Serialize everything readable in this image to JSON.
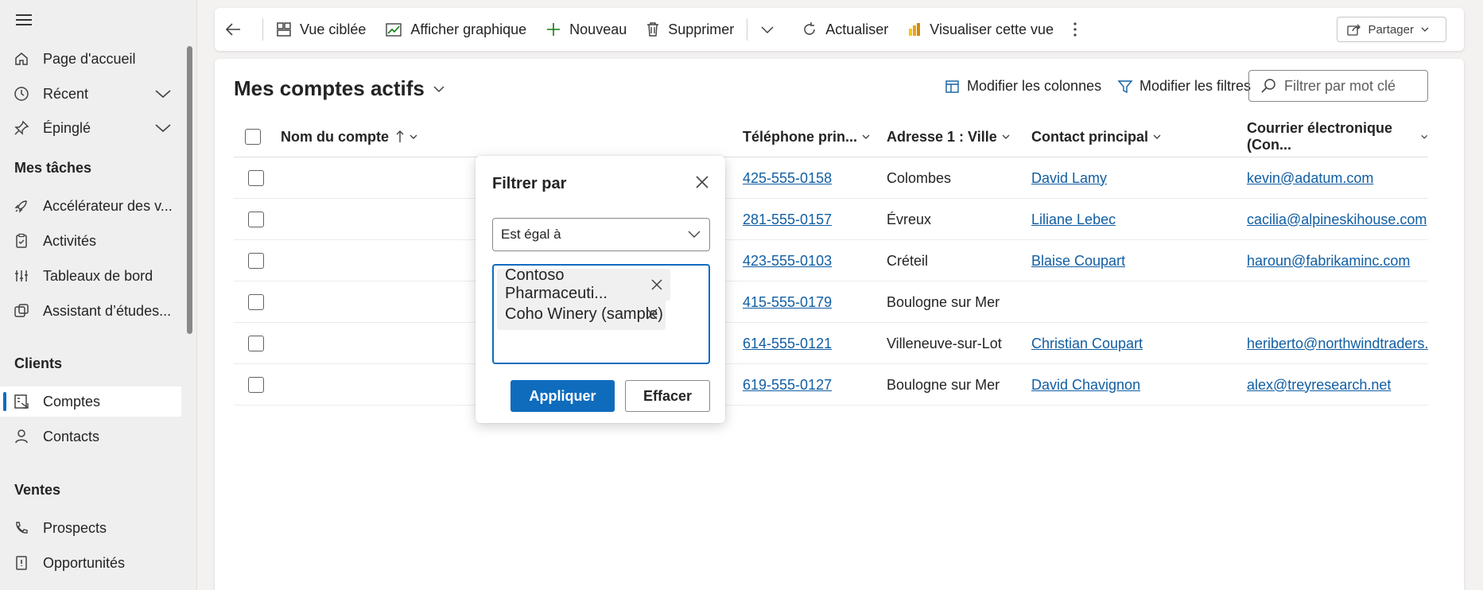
{
  "sidebar": {
    "items": [
      {
        "label": "Page d'accueil"
      },
      {
        "label": "Récent"
      },
      {
        "label": "Épinglé"
      },
      {
        "label": "Accélérateur des v..."
      },
      {
        "label": "Activités"
      },
      {
        "label": "Tableaux de bord"
      },
      {
        "label": "Assistant d’études..."
      },
      {
        "label": "Comptes"
      },
      {
        "label": "Contacts"
      },
      {
        "label": "Prospects"
      },
      {
        "label": "Opportunités"
      }
    ],
    "sections": [
      "Mes tâches",
      "Clients",
      "Ventes"
    ]
  },
  "toolbar": {
    "focused_view": "Vue ciblée",
    "show_chart": "Afficher graphique",
    "new": "Nouveau",
    "delete": "Supprimer",
    "refresh": "Actualiser",
    "visualize": "Visualiser cette vue",
    "share": "Partager"
  },
  "view": {
    "title": "Mes comptes actifs",
    "edit_columns": "Modifier les colonnes",
    "edit_filters": "Modifier les filtres",
    "search_placeholder": "Filtrer par mot clé"
  },
  "grid": {
    "columns": [
      "Nom du compte",
      "Téléphone prin...",
      "Adresse 1 : Ville",
      "Contact principal",
      "Courrier électronique (Con..."
    ],
    "rows": [
      {
        "phone": "425-555-0158",
        "city": "Colombes",
        "contact": "David Lamy",
        "email": "kevin@adatum.com"
      },
      {
        "phone": "281-555-0157",
        "city": "Évreux",
        "contact": "Liliane Lebec",
        "email": "cacilia@alpineskihouse.com"
      },
      {
        "phone": "423-555-0103",
        "city": "Créteil",
        "contact": "Blaise Coupart",
        "email": "haroun@fabrikaminc.com"
      },
      {
        "phone": "415-555-0179",
        "city": "Boulogne sur Mer",
        "contact": "",
        "email": ""
      },
      {
        "phone": "614-555-0121",
        "city": "Villeneuve-sur-Lot",
        "contact": "Christian Coupart",
        "email": "heriberto@northwindtraders..."
      },
      {
        "phone": "619-555-0127",
        "city": "Boulogne sur Mer",
        "contact": "David Chavignon",
        "email": "alex@treyresearch.net"
      }
    ]
  },
  "filter_popover": {
    "title": "Filtrer par",
    "operator": "Est égal à",
    "tags": [
      "Contoso Pharmaceuti...",
      "Coho Winery (sample)"
    ],
    "apply": "Appliquer",
    "clear": "Effacer"
  },
  "colors": {
    "accent": "#0f6cbd",
    "link": "#115ea3"
  }
}
